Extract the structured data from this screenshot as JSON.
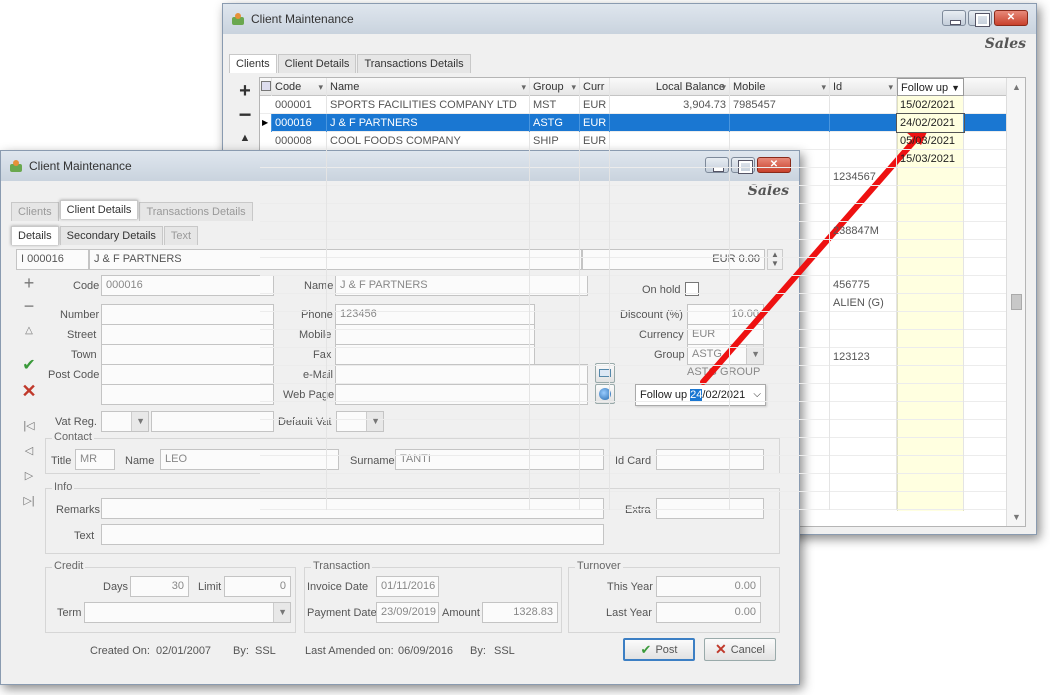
{
  "back_window": {
    "title": "Client Maintenance",
    "brand": "Sales",
    "tabs": [
      "Clients",
      "Client Details",
      "Transactions Details"
    ],
    "columns": [
      "Code",
      "Name",
      "Group",
      "Curr",
      "Local Balance",
      "Mobile",
      "Id",
      "Follow up"
    ],
    "rows": [
      {
        "code": "000001",
        "name": "SPORTS FACILITIES COMPANY LTD",
        "group": "MST",
        "curr": "EUR",
        "balance": "3,904.73",
        "mobile": "7985457",
        "id": "",
        "followup": "15/02/2021"
      },
      {
        "code": "000016",
        "name": "J & F PARTNERS",
        "group": "ASTG",
        "curr": "EUR",
        "balance": "",
        "mobile": "",
        "id": "",
        "followup": "24/02/2021"
      },
      {
        "code": "000008",
        "name": "COOL FOODS COMPANY",
        "group": "SHIP",
        "curr": "EUR",
        "balance": "",
        "mobile": "",
        "id": "",
        "followup": "05/03/2021"
      },
      {
        "code": "",
        "name": "",
        "group": "",
        "curr": "",
        "balance": "",
        "mobile": "",
        "id": "",
        "followup": "15/03/2021"
      },
      {
        "code": "",
        "name": "",
        "group": "",
        "curr": "",
        "balance": "",
        "mobile": "",
        "id": "1234567",
        "followup": ""
      },
      {
        "code": "",
        "name": "",
        "group": "",
        "curr": "",
        "balance": "",
        "mobile": "",
        "id": "",
        "followup": ""
      },
      {
        "code": "",
        "name": "",
        "group": "",
        "curr": "",
        "balance": "",
        "mobile": "",
        "id": "",
        "followup": ""
      },
      {
        "code": "",
        "name": "",
        "group": "",
        "curr": "",
        "balance": "",
        "mobile": "",
        "id": "238847M",
        "followup": ""
      },
      {
        "code": "",
        "name": "",
        "group": "",
        "curr": "",
        "balance": "",
        "mobile": "",
        "id": "",
        "followup": ""
      },
      {
        "code": "",
        "name": "",
        "group": "",
        "curr": "",
        "balance": "",
        "mobile": "",
        "id": "",
        "followup": ""
      },
      {
        "code": "",
        "name": "",
        "group": "",
        "curr": "",
        "balance": "",
        "mobile": "",
        "id": "456775",
        "followup": ""
      },
      {
        "code": "",
        "name": "",
        "group": "",
        "curr": "",
        "balance": "",
        "mobile": "",
        "id": "ALIEN (G)",
        "followup": ""
      },
      {
        "code": "",
        "name": "",
        "group": "",
        "curr": "",
        "balance": "",
        "mobile": "",
        "id": "",
        "followup": ""
      },
      {
        "code": "",
        "name": "",
        "group": "",
        "curr": "",
        "balance": "",
        "mobile": "",
        "id": "",
        "followup": ""
      },
      {
        "code": "",
        "name": "",
        "group": "",
        "curr": "",
        "balance": "",
        "mobile": "",
        "id": "123123",
        "followup": ""
      }
    ],
    "selected_row": 1
  },
  "front_window": {
    "title": "Client Maintenance",
    "brand": "Sales",
    "tabs": [
      "Clients",
      "Client Details",
      "Transactions Details"
    ],
    "subtabs": [
      "Details",
      "Secondary Details",
      "Text"
    ],
    "header": {
      "code": "000016",
      "name": "J & F PARTNERS",
      "balance": "EUR 0.00"
    },
    "labels": {
      "code": "Code",
      "name": "Name",
      "number": "Number",
      "street": "Street",
      "town": "Town",
      "post_code": "Post Code",
      "phone": "Phone",
      "mobile": "Mobile",
      "fax": "Fax",
      "email": "e-Mail",
      "web_page": "Web Page",
      "on_hold": "On hold",
      "discount": "Discount (%)",
      "currency": "Currency",
      "group": "Group",
      "follow_up": "Follow up",
      "vat_reg": "Vat Reg.",
      "default_vat": "Default Vat",
      "contact": "Contact",
      "title": "Title",
      "contact_name": "Name",
      "surname": "Surname",
      "id_card": "Id Card",
      "info": "Info",
      "remarks": "Remarks",
      "text": "Text",
      "extra": "Extra",
      "credit": "Credit",
      "days": "Days",
      "limit": "Limit",
      "term": "Term",
      "transaction": "Transaction",
      "invoice_date": "Invoice Date",
      "payment_date": "Payment Date",
      "amount": "Amount",
      "turnover": "Turnover",
      "this_year": "This Year",
      "last_year": "Last Year",
      "created_on": "Created On:",
      "by": "By:",
      "last_amended": "Last Amended on:"
    },
    "values": {
      "code": "000016",
      "name": "J & F PARTNERS",
      "phone": "123456",
      "discount": "10.00",
      "currency": "EUR",
      "group": "ASTG",
      "group_desc": "ASTG GROUP",
      "follow_up_day": "24",
      "follow_up_rest": "/02/2021",
      "title": "MR",
      "contact_name": "LEO",
      "surname": "TANTI",
      "days": "30",
      "limit": "0",
      "invoice_date": "01/11/2016",
      "payment_date": "23/09/2019",
      "amount": "1328.83",
      "this_year": "0.00",
      "last_year": "0.00",
      "created_on": "02/01/2007",
      "created_by": "SSL",
      "last_amended": "06/09/2016",
      "amended_by": "SSL"
    },
    "buttons": {
      "post": "Post",
      "cancel": "Cancel"
    }
  },
  "colors": {
    "selection": "#1a77d2",
    "arrow": "#ee1111",
    "followup_bg": "#ffffe0"
  }
}
